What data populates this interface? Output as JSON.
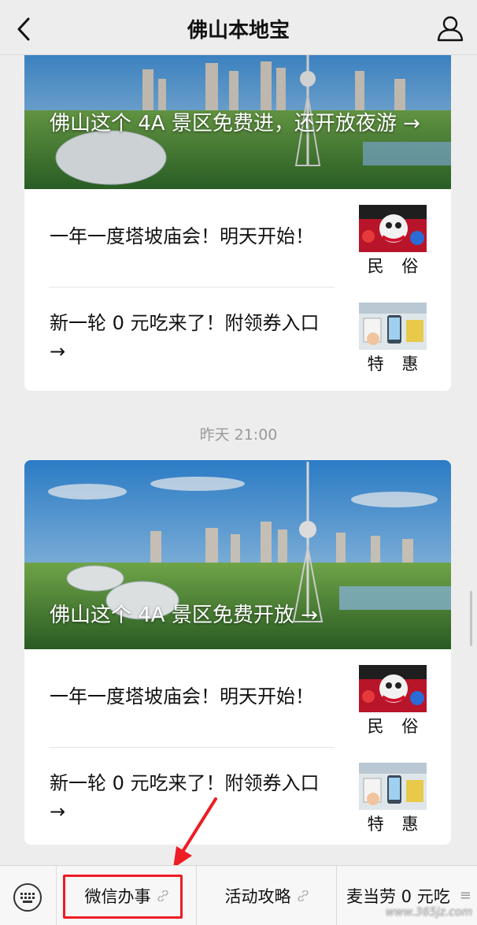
{
  "header": {
    "title": "佛山本地宝"
  },
  "feed": {
    "card1": {
      "cover_title": "佛山这个 4A 景区免费进，还开放夜游 →",
      "items": [
        {
          "text": "一年一度塔坡庙会！明天开始！",
          "tag": "民 俗"
        },
        {
          "text": "新一轮 0 元吃来了！附领券入口 →",
          "tag": "特 惠"
        }
      ]
    },
    "timestamp": "昨天 21:00",
    "card2": {
      "cover_title": "佛山这个 4A 景区免费开放 →",
      "items": [
        {
          "text": "一年一度塔坡庙会！明天开始！",
          "tag": "民 俗"
        },
        {
          "text": "新一轮 0 元吃来了！附领券入口 →",
          "tag": "特 惠"
        }
      ]
    }
  },
  "menu": {
    "items": [
      "微信办事",
      "活动攻略",
      "麦当劳 0 元吃"
    ]
  },
  "watermark": "www.365jz.com",
  "colors": {
    "highlight": "#ee1c24",
    "background": "#ededed"
  }
}
